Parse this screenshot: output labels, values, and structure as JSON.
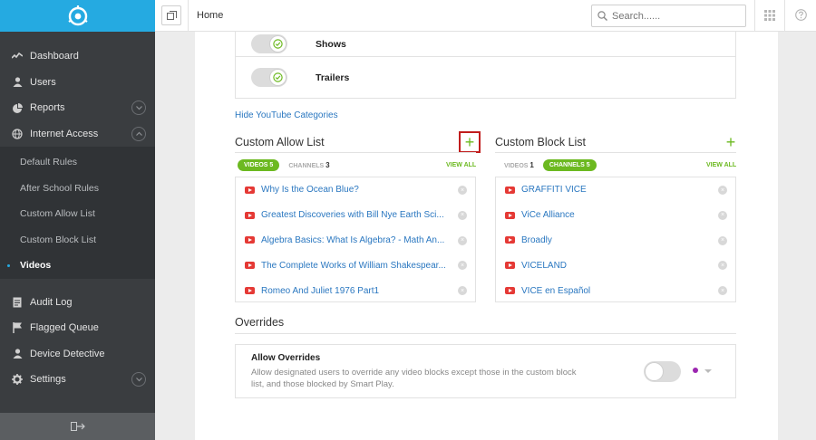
{
  "sidebar": {
    "items": [
      {
        "label": "Dashboard",
        "icon": "activity-icon"
      },
      {
        "label": "Users",
        "icon": "user-icon"
      },
      {
        "label": "Reports",
        "icon": "pie-chart-icon"
      },
      {
        "label": "Internet Access",
        "icon": "globe-icon"
      }
    ],
    "subitems": [
      {
        "label": "Default Rules"
      },
      {
        "label": "After School Rules"
      },
      {
        "label": "Custom Allow List"
      },
      {
        "label": "Custom Block List"
      },
      {
        "label": "Videos"
      }
    ],
    "items2": [
      {
        "label": "Audit Log",
        "icon": "document-icon"
      },
      {
        "label": "Flagged Queue",
        "icon": "flag-icon"
      },
      {
        "label": "Device Detective",
        "icon": "user-search-icon"
      },
      {
        "label": "Settings",
        "icon": "gear-icon"
      }
    ]
  },
  "topbar": {
    "title": "Home",
    "search_placeholder": "Search......"
  },
  "categories": [
    {
      "label": "Shows",
      "enabled": true
    },
    {
      "label": "Trailers",
      "enabled": true
    }
  ],
  "hide_categories_link": "Hide YouTube Categories",
  "allow_list": {
    "title": "Custom Allow List",
    "tab_active": {
      "label": "VIDEOS",
      "count": "5"
    },
    "tab_other": {
      "label": "CHANNELS",
      "count": "3"
    },
    "view_all": "VIEW ALL",
    "items": [
      "Why Is the Ocean Blue?",
      "Greatest Discoveries with Bill Nye Earth Sci...",
      "Algebra Basics: What Is Algebra? - Math An...",
      "The Complete Works of William Shakespear...",
      "Romeo And Juliet 1976 Part1"
    ]
  },
  "block_list": {
    "title": "Custom Block List",
    "tab_other": {
      "label": "VIDEOS",
      "count": "1"
    },
    "tab_active": {
      "label": "CHANNELS",
      "count": "5"
    },
    "view_all": "VIEW ALL",
    "items": [
      "GRAFFITI VICE",
      "ViCe Alliance",
      "Broadly",
      "VICELAND",
      "VICE en Español"
    ]
  },
  "overrides": {
    "title": "Overrides",
    "heading": "Allow Overrides",
    "description": "Allow designated users to override any video blocks except those in the custom block list, and those blocked by Smart Play.",
    "enabled": false
  },
  "colors": {
    "brand": "#25aae1",
    "accent_green": "#6cb920",
    "link_blue": "#2a77c0",
    "highlight_red": "#c11d1d",
    "youtube_red": "#e53935"
  }
}
